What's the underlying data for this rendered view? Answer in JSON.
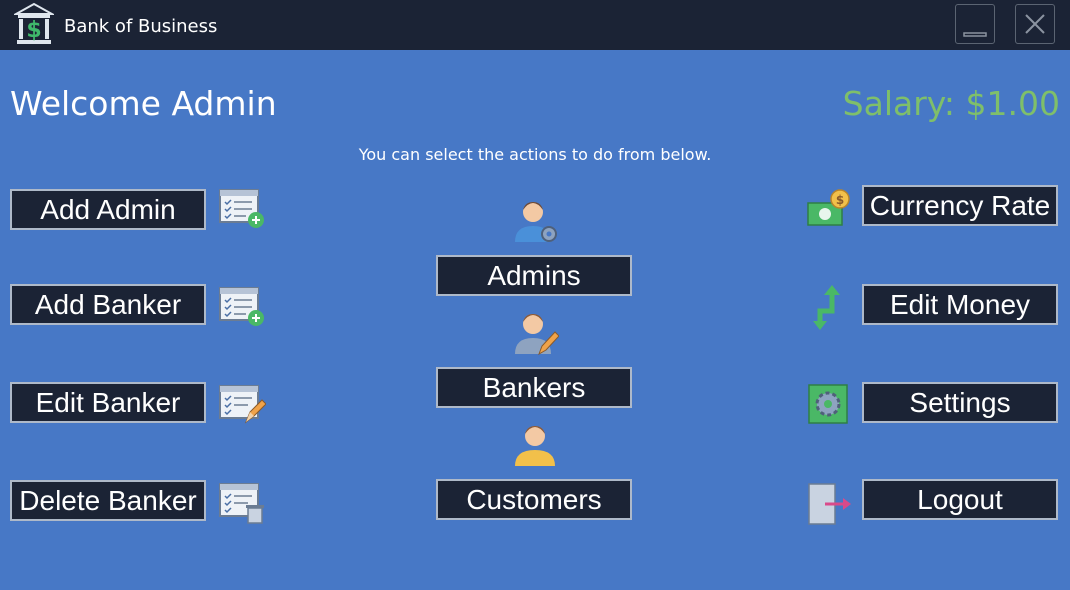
{
  "window": {
    "title": "Bank of Business",
    "logo_icon": "bank-dollar-icon",
    "minimize_icon": "minimize-icon",
    "close_icon": "close-icon"
  },
  "header": {
    "welcome": "Welcome Admin",
    "salary": "Salary: $1.00",
    "subtitle": "You can select the actions to do from below."
  },
  "left_actions": [
    {
      "label": "Add Admin",
      "icon": "checklist-add-icon"
    },
    {
      "label": "Add Banker",
      "icon": "checklist-add-icon"
    },
    {
      "label": "Edit Banker",
      "icon": "checklist-edit-icon"
    },
    {
      "label": "Delete Banker",
      "icon": "checklist-delete-icon"
    }
  ],
  "center_actions": [
    {
      "label": "Admins",
      "icon": "admin-user-gear-icon"
    },
    {
      "label": "Bankers",
      "icon": "banker-user-pencil-icon"
    },
    {
      "label": "Customers",
      "icon": "customer-user-icon"
    }
  ],
  "right_actions": [
    {
      "label": "Currency Rate",
      "icon": "money-coin-icon"
    },
    {
      "label": "Edit Money",
      "icon": "transfer-arrows-icon"
    },
    {
      "label": "Settings",
      "icon": "settings-gear-icon"
    },
    {
      "label": "Logout",
      "icon": "logout-door-icon"
    }
  ],
  "colors": {
    "background": "#4778c6",
    "titlebar": "#1b2335",
    "button": "#1b2335",
    "salary": "#7fbf6a"
  }
}
